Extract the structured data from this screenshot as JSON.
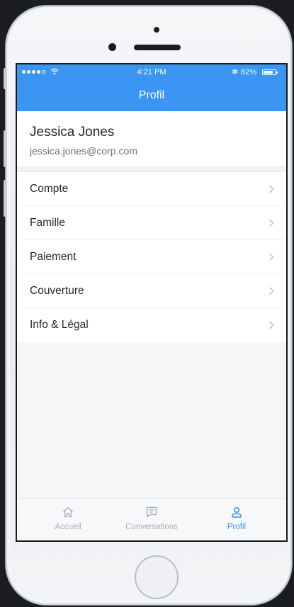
{
  "statusbar": {
    "time": "4:21 PM",
    "battery": "82%",
    "battery_level": 0.82,
    "signal_bars": 4,
    "signal_total": 5
  },
  "header": {
    "title": "Profil",
    "color": "#3a96f2"
  },
  "user": {
    "name": "Jessica Jones",
    "email": "jessica.jones@corp.com"
  },
  "menu": {
    "items": [
      {
        "label": "Compte",
        "icon": "chevron-right-icon"
      },
      {
        "label": "Famille",
        "icon": "chevron-right-icon"
      },
      {
        "label": "Paiement",
        "icon": "chevron-right-icon"
      },
      {
        "label": "Couverture",
        "icon": "chevron-right-icon"
      },
      {
        "label": "Info & Légal",
        "icon": "chevron-right-icon"
      }
    ]
  },
  "tabbar": {
    "tabs": [
      {
        "label": "Accueil",
        "icon": "home-icon",
        "active": false
      },
      {
        "label": "Conversations",
        "icon": "chat-icon",
        "active": false
      },
      {
        "label": "Profil",
        "icon": "user-icon",
        "active": true
      }
    ],
    "active_color": "#3a96f2",
    "inactive_color": "#a9adb4"
  }
}
